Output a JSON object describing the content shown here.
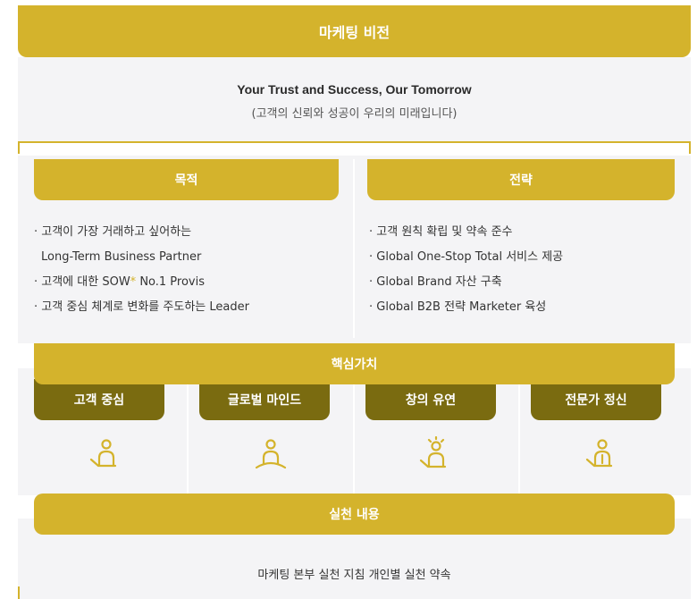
{
  "vision": {
    "title": "마케팅 비전"
  },
  "slogan": {
    "english": "Your Trust and Success, Our Tomorrow",
    "korean": "(고객의 신뢰와 성공이 우리의 미래입니다)"
  },
  "purpose": {
    "title": "목적",
    "items": [
      "· 고객이 가장 거래하고 싶어하는",
      "Long-Term Business Partner",
      "· 고객에 대한 SOW",
      "No.1 Provis",
      "· 고객 중심 체계로 변화를 주도하는 Leader"
    ],
    "star": "*"
  },
  "strategy": {
    "title": "전략",
    "items": [
      "· 고객 원칙 확립 및 약속 준수",
      "· Global One-Stop Total 서비스 제공",
      "· Global Brand 자산 구축",
      "· Global B2B 전략 Marketer 육성"
    ]
  },
  "core_values": {
    "title": "핵심가치",
    "cards": [
      {
        "label": "고객 중심",
        "icon": "person-bowing-icon"
      },
      {
        "label": "글로벌 마인드",
        "icon": "person-open-arms-icon"
      },
      {
        "label": "창의 유연",
        "icon": "person-idea-icon"
      },
      {
        "label": "전문가 정신",
        "icon": "person-expert-icon"
      }
    ]
  },
  "practice": {
    "title": "실천 내용",
    "description": "마케팅 본부 실천 지침 개인별 실천 약속"
  },
  "colors": {
    "gold": "#d4b32c",
    "dark_gold": "#7a6b10",
    "panel": "#f4f4f6"
  }
}
